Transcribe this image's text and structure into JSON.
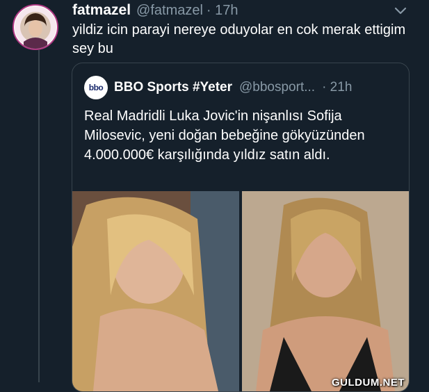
{
  "tweet": {
    "display_name": "fatmazel",
    "handle": "@fatmazel",
    "time": "· 17h",
    "text": "yildiz icin parayi nereye oduyolar en cok merak ettigim sey bu",
    "avatar_icon": "profile-photo-with-badge-ring"
  },
  "quoted": {
    "display_name": "BBO Sports #Yeter",
    "handle": "@bbosport...",
    "time": "· 21h",
    "logo_text": "bbo",
    "text": "Real Madridli Luka Jovic'in nişanlısı Sofija Milosevic, yeni doğan bebeğine gökyüzünden 4.000.000€ karşılığında yıldız satın aldı."
  },
  "watermark": "GULDUM.NET",
  "colors": {
    "background": "#15202b",
    "secondary_text": "#8899a6",
    "border": "#38444d"
  }
}
